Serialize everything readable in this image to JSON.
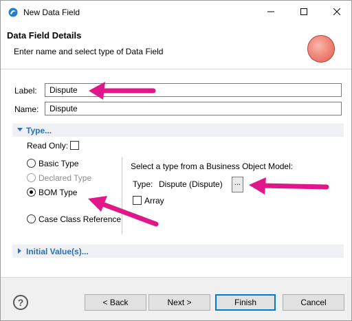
{
  "window": {
    "title": "New Data Field"
  },
  "banner": {
    "title": "Data Field Details",
    "description": "Enter name and select type of Data Field"
  },
  "fields": {
    "label_caption": "Label:",
    "label_value": "Dispute",
    "name_caption": "Name:",
    "name_value": "Dispute"
  },
  "type_section": {
    "header": "Type...",
    "read_only_label": "Read Only:",
    "read_only_checked": false,
    "options": [
      {
        "label": "Basic Type",
        "selected": false,
        "enabled": true
      },
      {
        "label": "Declared Type",
        "selected": false,
        "enabled": false
      },
      {
        "label": "BOM Type",
        "selected": true,
        "enabled": true
      },
      {
        "label": "Case Class Reference",
        "selected": false,
        "enabled": true
      }
    ],
    "bom_prompt": "Select a type from a Business Object Model:",
    "type_caption": "Type:",
    "type_value": "Dispute (Dispute)",
    "browse_label": "...",
    "array_label": "Array",
    "array_checked": false
  },
  "initial_section": {
    "header": "Initial Value(s)..."
  },
  "footer": {
    "help_label": "?",
    "back_label": "< Back",
    "next_label": "Next >",
    "finish_label": "Finish",
    "cancel_label": "Cancel"
  },
  "colors": {
    "link_blue": "#2a6fb5",
    "annotation_arrow": "#e0168b",
    "orb": "#f08a7d"
  },
  "icons": {
    "app": "app-swirl-icon",
    "minimize": "minimize-icon",
    "maximize": "maximize-icon",
    "close": "close-icon",
    "help": "help-icon"
  }
}
